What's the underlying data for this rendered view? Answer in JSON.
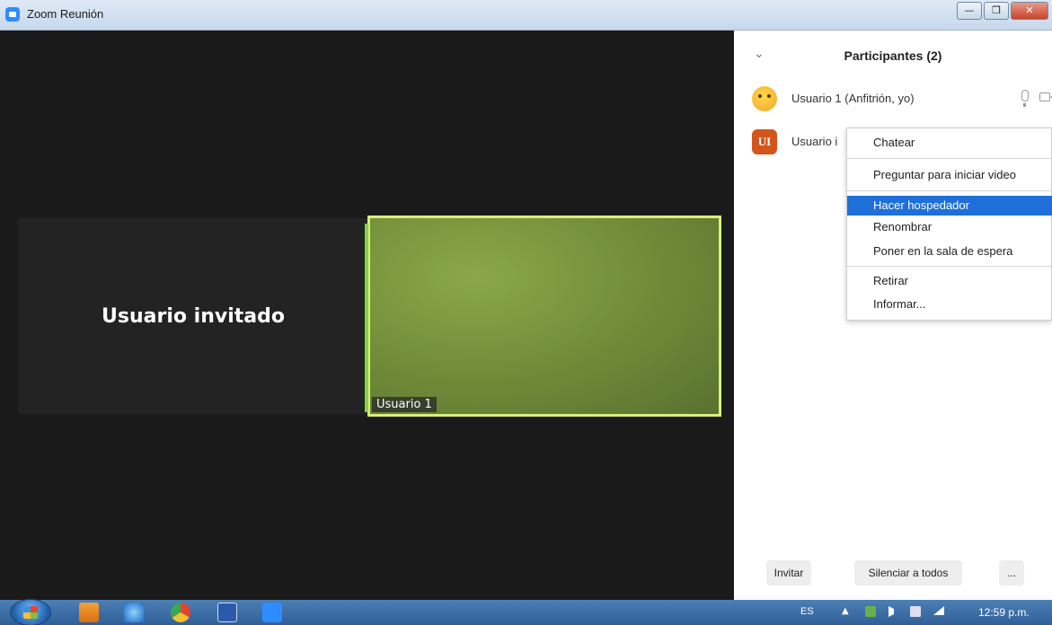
{
  "window": {
    "title": "Zoom Reunión",
    "controls": [
      "minimize",
      "restore",
      "close"
    ]
  },
  "video": {
    "guest_tile_name": "Usuario invitado",
    "self_tile_label": "Usuario 1"
  },
  "participants": {
    "title": "Participantes (2)",
    "items": [
      {
        "name": "Usuario 1 (Anfitrión, yo)",
        "avatar": "emoji-thinking"
      },
      {
        "name": "Usuario i",
        "avatar_initials": "UI"
      }
    ],
    "footer": {
      "invite_label": "Invitar",
      "mute_all_label": "Silenciar a todos",
      "more_label": "..."
    }
  },
  "context_menu": {
    "selected": "Hacer hospedador",
    "items": [
      "Chatear",
      "Preguntar para iniciar video",
      "Hacer hospedador",
      "Renombrar",
      "Poner en la sala de espera",
      "Retirar",
      "Informar..."
    ],
    "accent": "#1e6fd9"
  },
  "taskbar": {
    "language": "ES",
    "clock": "12:59 p.m.",
    "pinned": [
      "media-player-icon",
      "internet-explorer-icon",
      "chrome-icon",
      "word-icon",
      "zoom-icon"
    ]
  },
  "colors": {
    "active_speaker_border": "#d8f07a",
    "initials_avatar": "#d2561c"
  }
}
